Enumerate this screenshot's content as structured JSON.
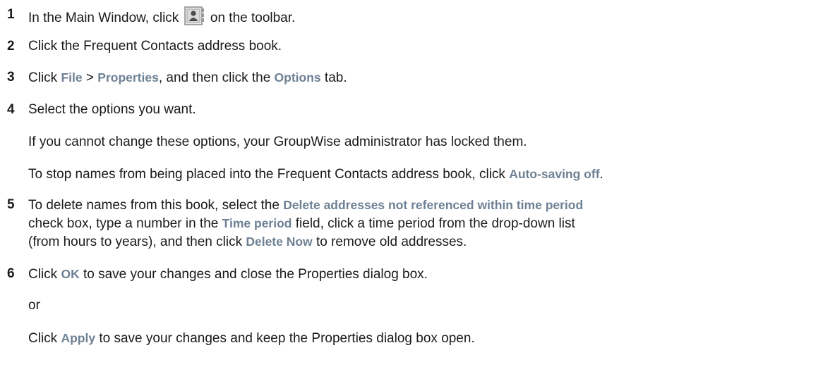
{
  "steps": [
    {
      "number": "1",
      "parts": [
        "In the Main Window, click ",
        " on the toolbar."
      ],
      "icon": "address-book-icon"
    },
    {
      "number": "2",
      "text": "Click the Frequent Contacts address book."
    },
    {
      "number": "3",
      "parts": [
        "Click ",
        "File",
        " > ",
        "Properties",
        ", and then click the ",
        "Options",
        " tab."
      ]
    },
    {
      "number": "4",
      "text": "Select the options you want.",
      "note1": "If you cannot change these options, your GroupWise administrator has locked them.",
      "note2_parts": [
        "To stop names from being placed into the Frequent Contacts address book, click ",
        "Auto-saving off",
        "."
      ]
    },
    {
      "number": "5",
      "line1_parts": [
        "To delete names from this book, select the ",
        "Delete addresses not referenced within time period"
      ],
      "line2_parts": [
        "check box, type a number in the ",
        "Time period",
        " field, click a time period from the drop-down list"
      ],
      "line3_parts": [
        "(from hours to years), and then click ",
        "Delete Now",
        " to remove old addresses."
      ]
    },
    {
      "number": "6",
      "parts": [
        "Click ",
        "OK",
        " to save your changes and close the Properties dialog box."
      ],
      "or": "or",
      "alt_parts": [
        "Click ",
        "Apply",
        " to save your changes and keep the Properties dialog box open."
      ]
    }
  ],
  "colors": {
    "ui_text": "#6e8194",
    "body_text": "#1a1a1a"
  }
}
